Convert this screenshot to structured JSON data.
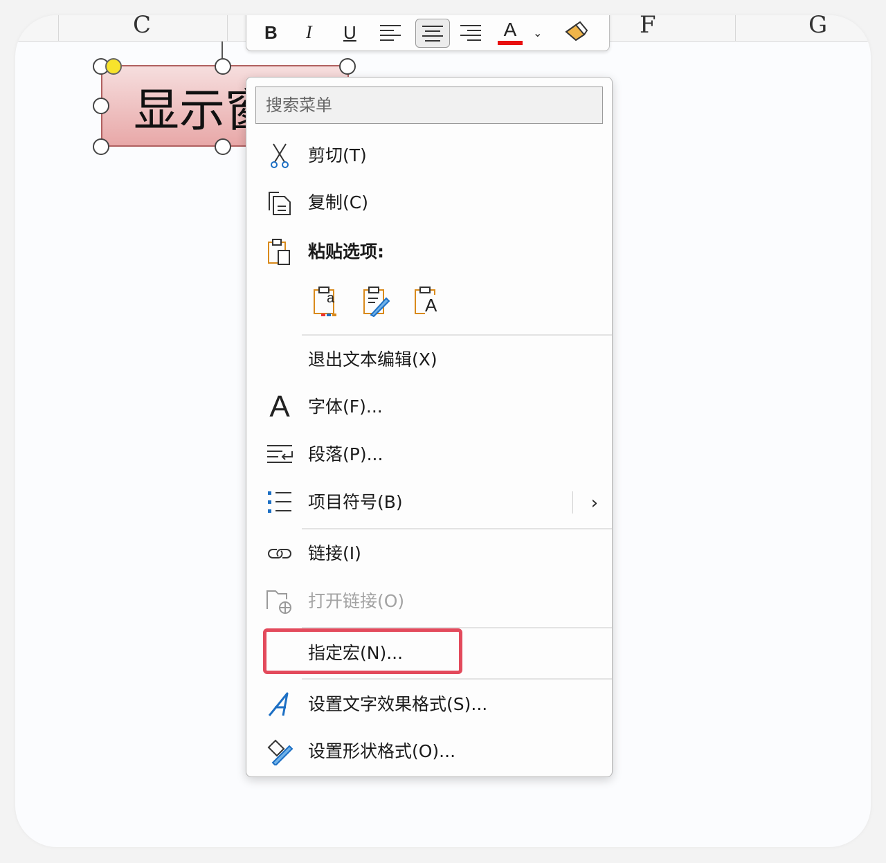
{
  "columns": [
    "C",
    "F",
    "G"
  ],
  "shape": {
    "text": "显示窗"
  },
  "mini_toolbar": {
    "bold": "B",
    "italic": "I",
    "underline": "U",
    "font_color_letter": "A",
    "dropdown": "⌄",
    "font_color": "#e81010"
  },
  "menu": {
    "search_placeholder": "搜索菜单",
    "items": {
      "cut": "剪切(T)",
      "copy": "复制(C)",
      "paste_options": "粘贴选项:",
      "exit_text_edit": "退出文本编辑(X)",
      "font": "字体(F)...",
      "paragraph": "段落(P)...",
      "bullets": "项目符号(B)",
      "link": "链接(I)",
      "open_link": "打开链接(O)",
      "assign_macro": "指定宏(N)...",
      "format_text_effects": "设置文字效果格式(S)...",
      "format_shape": "设置形状格式(O)..."
    },
    "paste_option_glyphs": [
      "a",
      "A"
    ],
    "font_icon_glyph": "A",
    "submenu_arrow": "›"
  },
  "colors": {
    "highlight_box": "#e34a5c",
    "shape_fill": "#eeb9b9",
    "icon_blue": "#1c6fc4",
    "icon_orange": "#d98a1c"
  }
}
